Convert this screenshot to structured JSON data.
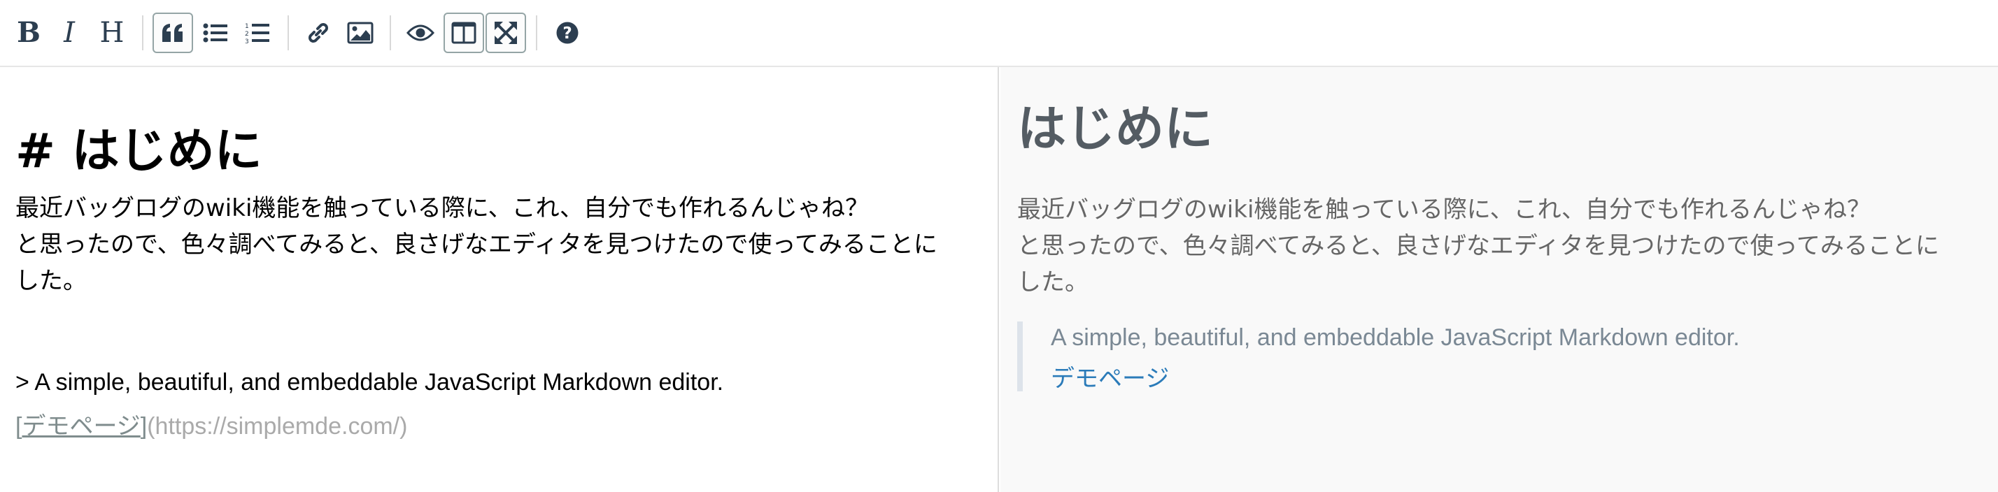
{
  "toolbar": {
    "buttons": [
      {
        "name": "bold-button",
        "icon": "bold-icon",
        "glyph": "B",
        "active": false
      },
      {
        "name": "italic-button",
        "icon": "italic-icon",
        "glyph": "I",
        "active": false
      },
      {
        "name": "heading-button",
        "icon": "heading-icon",
        "glyph": "H",
        "active": false
      },
      {
        "name": "quote-button",
        "icon": "quote-icon",
        "active": true
      },
      {
        "name": "unordered-list-button",
        "icon": "bulleted-list-icon",
        "active": false
      },
      {
        "name": "ordered-list-button",
        "icon": "numbered-list-icon",
        "active": false
      },
      {
        "name": "link-button",
        "icon": "link-icon",
        "active": false
      },
      {
        "name": "image-button",
        "icon": "image-icon",
        "active": false
      },
      {
        "name": "preview-button",
        "icon": "eye-icon",
        "active": false
      },
      {
        "name": "side-by-side-button",
        "icon": "columns-icon",
        "active": true
      },
      {
        "name": "fullscreen-button",
        "icon": "arrows-alt-icon",
        "active": true
      },
      {
        "name": "guide-button",
        "icon": "question-circle-icon",
        "active": false
      }
    ]
  },
  "editor": {
    "heading": "# はじめに",
    "para_line1": "最近バッグログのwiki機能を触っている際に、これ、自分でも作れるんじゃね？",
    "para_line2": "と思ったので、色々調べてみると、良さげなエディタを見つけたので使ってみることに",
    "para_line3": "した。",
    "quote_line": "> A simple, beautiful, and embeddable JavaScript Markdown editor.",
    "link_open": "[",
    "link_text": "デモページ",
    "link_close": "]",
    "link_url": "(https://simplemde.com/)"
  },
  "preview": {
    "heading": "はじめに",
    "para_line1": "最近バッグログのwiki機能を触っている際に、これ、自分でも作れるんじゃね？",
    "para_line2": "と思ったので、色々調べてみると、良さげなエディタを見つけたので使ってみることに",
    "para_line3": "した。",
    "quote_text": "A simple, beautiful, and embeddable JavaScript Markdown editor.",
    "link_text": "デモページ"
  },
  "colors": {
    "toolbar_icon": "#2c3e50",
    "preview_bg": "#f9f9f9",
    "preview_link": "#2b7bb9"
  }
}
